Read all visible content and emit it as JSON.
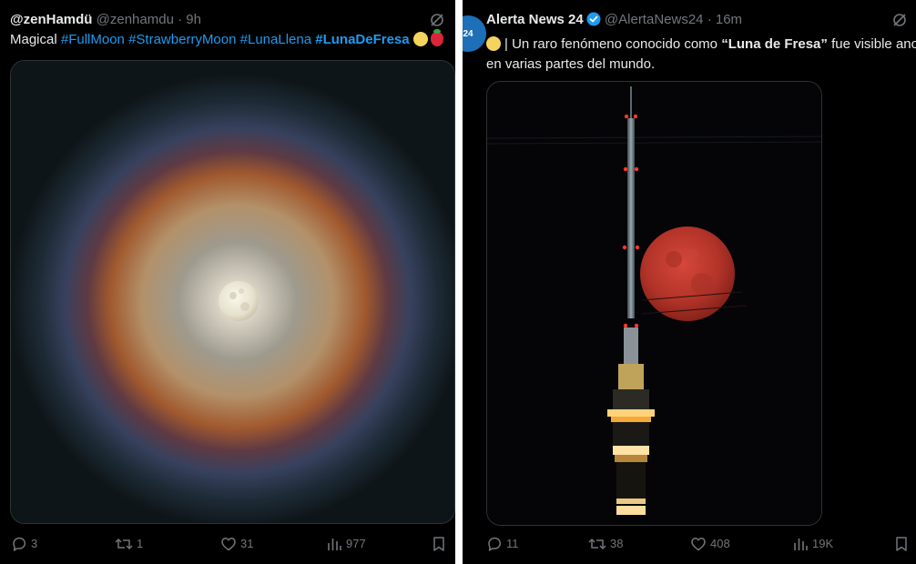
{
  "left_tweet": {
    "display_name": "@zenHamdü",
    "handle": "@zenhamdu",
    "separator": "·",
    "time": "9h",
    "text_prefix": "Magical",
    "hashtags": [
      "#FullMoon",
      "#StrawberryMoon",
      "#LunaLlena",
      "#LunaDeFresa"
    ],
    "emojis": [
      "full-moon-emoji",
      "strawberry-emoji"
    ],
    "media_icon": "halo-moon-photo",
    "stats": {
      "replies": "3",
      "reposts": "1",
      "likes": "31",
      "views": "977"
    }
  },
  "right_tweet": {
    "avatar_label": "24",
    "display_name": "Alerta News 24",
    "handle": "@AlertaNews24",
    "separator": "·",
    "time": "16m",
    "text_line1_a": "| Un raro fenómeno conocido como ",
    "text_line1_bold": "“Luna de Fresa”",
    "text_line1_b": " fue visible anoche",
    "text_line2": "en varias partes del mundo.",
    "media_icon": "red-moon-tower-photo",
    "stats": {
      "replies": "11",
      "reposts": "38",
      "likes": "408",
      "views": "19K"
    }
  },
  "colors": {
    "background": "#000000",
    "text": "#e7e9ea",
    "muted": "#71767b",
    "link": "#1d9bf0",
    "verified": "#1d9bf0",
    "border": "#2f3336"
  }
}
